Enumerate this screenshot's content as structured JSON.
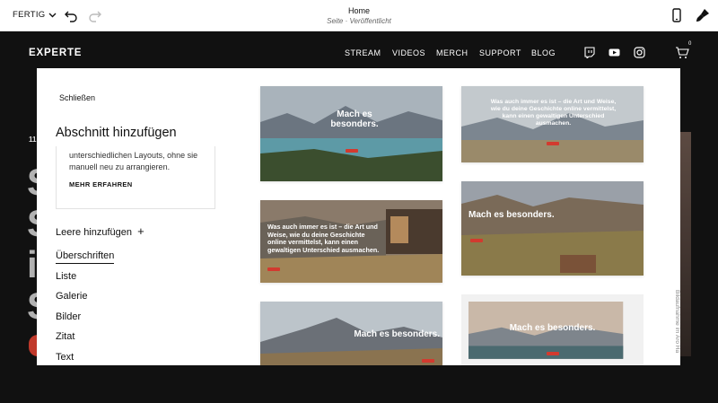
{
  "topbar": {
    "done_label": "FERTIG",
    "page_title": "Home",
    "page_status": "Seite · Veröffentlicht"
  },
  "site": {
    "logo": "EXPERTE",
    "nav": [
      "STREAM",
      "VIDEOS",
      "MERCH",
      "SUPPORT",
      "BLOG"
    ],
    "cart_count": "0",
    "bg_date": "11.",
    "bg_letters": [
      "S",
      "S",
      "i",
      "S"
    ]
  },
  "modal": {
    "close_label": "Schließen",
    "title": "Abschnitt hinzufügen",
    "info_text": "unterschiedlichen Layouts, ohne sie manuell neu zu arrangieren.",
    "info_link": "MEHR ERFAHREN",
    "blank_label": "Leere hinzufügen",
    "blank_plus": "+",
    "categories": [
      "Überschriften",
      "Liste",
      "Galerie",
      "Bilder",
      "Zitat",
      "Text"
    ],
    "active_category": "Überschriften",
    "credit": "Bildaufnahme im Aro Ha"
  },
  "thumbnails": [
    {
      "heading": "Mach es besonders."
    },
    {
      "heading": "Was auch immer es ist – die Art und Weise, wie du deine Geschichte online vermittelst, kann einen gewaltigen Unterschied ausmachen."
    },
    {
      "heading": "Was auch immer es ist – die Art und Weise, wie du deine Geschichte online vermittelst, kann einen gewaltigen Unterschied ausmachen."
    },
    {
      "heading": "Mach es besonders."
    },
    {
      "heading": "Mach es besonders."
    },
    {
      "heading": "Mach es besonders."
    }
  ]
}
